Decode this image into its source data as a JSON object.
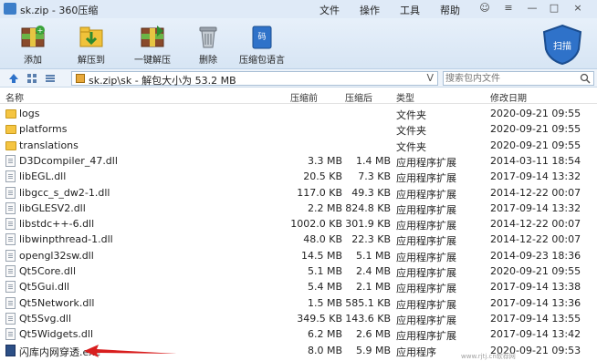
{
  "window": {
    "title": "sk.zip - 360压缩",
    "menus": [
      "文件",
      "操作",
      "工具",
      "帮助"
    ],
    "controls": [
      "☺",
      "≡",
      "—",
      "□",
      "×"
    ]
  },
  "toolbar": {
    "buttons": [
      {
        "label": "添加",
        "icon": "add-archive-icon"
      },
      {
        "label": "解压到",
        "icon": "extract-to-icon"
      },
      {
        "label": "一键解压",
        "icon": "one-click-extract-icon"
      },
      {
        "label": "删除",
        "icon": "trash-icon"
      },
      {
        "label": "压缩包语言",
        "icon": "archive-language-icon"
      }
    ],
    "scan_label": "扫描"
  },
  "address": {
    "path": "sk.zip\\sk - 解包大小为 53.2 MB",
    "dropdown": "V",
    "search_placeholder": "搜索包内文件"
  },
  "columns": {
    "name": "名称",
    "size": "压缩前",
    "compressed": "压缩后",
    "type": "类型",
    "modified": "修改日期"
  },
  "files": [
    {
      "name": "logs",
      "size": "",
      "csize": "",
      "type": "文件夹",
      "date": "2020-09-21 09:55",
      "kind": "folder"
    },
    {
      "name": "platforms",
      "size": "",
      "csize": "",
      "type": "文件夹",
      "date": "2020-09-21 09:55",
      "kind": "folder"
    },
    {
      "name": "translations",
      "size": "",
      "csize": "",
      "type": "文件夹",
      "date": "2020-09-21 09:55",
      "kind": "folder"
    },
    {
      "name": "D3Dcompiler_47.dll",
      "size": "3.3 MB",
      "csize": "1.4 MB",
      "type": "应用程序扩展",
      "date": "2014-03-11 18:54",
      "kind": "file"
    },
    {
      "name": "libEGL.dll",
      "size": "20.5 KB",
      "csize": "7.3 KB",
      "type": "应用程序扩展",
      "date": "2017-09-14 13:32",
      "kind": "file"
    },
    {
      "name": "libgcc_s_dw2-1.dll",
      "size": "117.0 KB",
      "csize": "49.3 KB",
      "type": "应用程序扩展",
      "date": "2014-12-22 00:07",
      "kind": "file"
    },
    {
      "name": "libGLESV2.dll",
      "size": "2.2 MB",
      "csize": "824.8 KB",
      "type": "应用程序扩展",
      "date": "2017-09-14 13:32",
      "kind": "file"
    },
    {
      "name": "libstdc++-6.dll",
      "size": "1002.0 KB",
      "csize": "301.9 KB",
      "type": "应用程序扩展",
      "date": "2014-12-22 00:07",
      "kind": "file"
    },
    {
      "name": "libwinpthread-1.dll",
      "size": "48.0 KB",
      "csize": "22.3 KB",
      "type": "应用程序扩展",
      "date": "2014-12-22 00:07",
      "kind": "file"
    },
    {
      "name": "opengl32sw.dll",
      "size": "14.5 MB",
      "csize": "5.1 MB",
      "type": "应用程序扩展",
      "date": "2014-09-23 18:36",
      "kind": "file"
    },
    {
      "name": "Qt5Core.dll",
      "size": "5.1 MB",
      "csize": "2.4 MB",
      "type": "应用程序扩展",
      "date": "2020-09-21 09:55",
      "kind": "file"
    },
    {
      "name": "Qt5Gui.dll",
      "size": "5.4 MB",
      "csize": "2.1 MB",
      "type": "应用程序扩展",
      "date": "2017-09-14 13:38",
      "kind": "file"
    },
    {
      "name": "Qt5Network.dll",
      "size": "1.5 MB",
      "csize": "585.1 KB",
      "type": "应用程序扩展",
      "date": "2017-09-14 13:36",
      "kind": "file"
    },
    {
      "name": "Qt5Svg.dll",
      "size": "349.5 KB",
      "csize": "143.6 KB",
      "type": "应用程序扩展",
      "date": "2017-09-14 13:55",
      "kind": "file"
    },
    {
      "name": "Qt5Widgets.dll",
      "size": "6.2 MB",
      "csize": "2.6 MB",
      "type": "应用程序扩展",
      "date": "2017-09-14 13:42",
      "kind": "file"
    },
    {
      "name": "闪库内网穿透.exe",
      "size": "8.0 MB",
      "csize": "5.9 MB",
      "type": "应用程序",
      "date": "2020-09-21 09:53",
      "kind": "exe"
    }
  ],
  "colors": {
    "accent": "#2f6fbf",
    "annotation_arrow": "#d81e1e",
    "folder": "#f5c542"
  },
  "watermark": "www.rjtj.cn软荐网"
}
